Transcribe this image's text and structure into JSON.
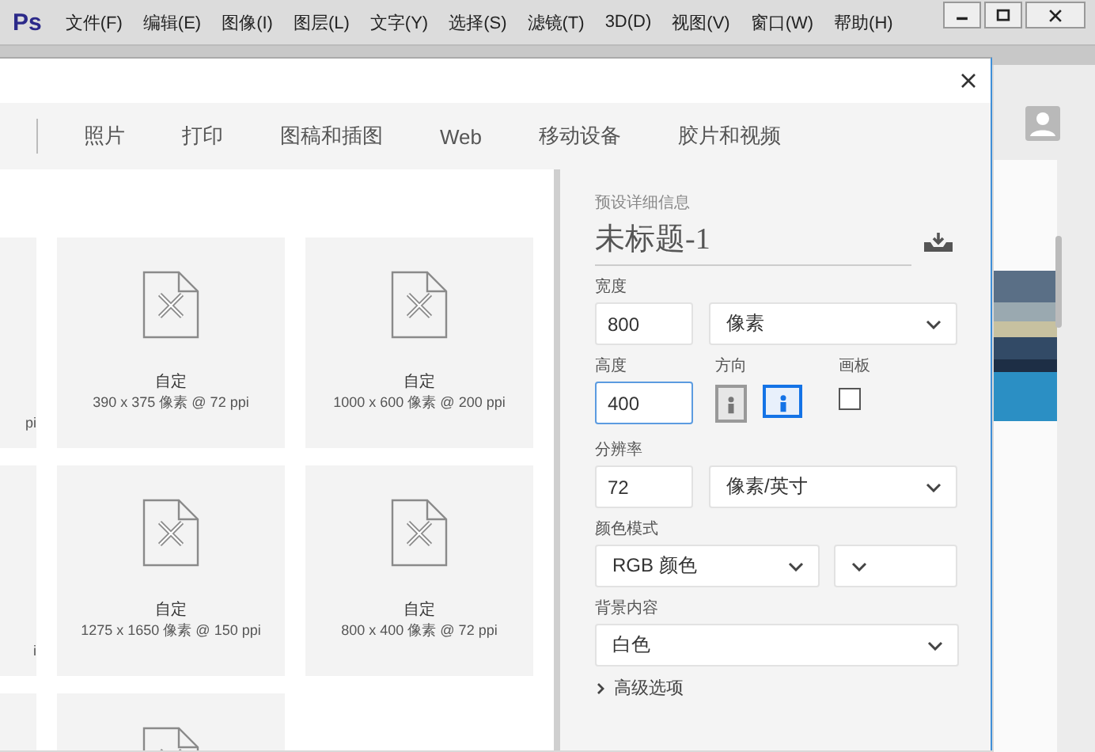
{
  "app": {
    "logo": "Ps",
    "menu": [
      "文件(F)",
      "编辑(E)",
      "图像(I)",
      "图层(L)",
      "文字(Y)",
      "选择(S)",
      "滤镜(T)",
      "3D(D)",
      "视图(V)",
      "窗口(W)",
      "帮助(H)"
    ]
  },
  "dialog": {
    "tabs": [
      {
        "label": "照片"
      },
      {
        "label": "打印"
      },
      {
        "label": "图稿和插图"
      },
      {
        "label": "Web"
      },
      {
        "label": "移动设备"
      },
      {
        "label": "胶片和视频"
      }
    ],
    "presets": [
      {
        "kind": "partial",
        "detail": "pi"
      },
      {
        "kind": "card",
        "name": "自定",
        "detail": "390 x 375 像素 @ 72 ppi"
      },
      {
        "kind": "card",
        "name": "自定",
        "detail": "1000 x 600 像素 @ 200 ppi"
      },
      {
        "kind": "partial",
        "detail": "i"
      },
      {
        "kind": "card",
        "name": "自定",
        "detail": "1275 x 1650 像素 @ 150 ppi"
      },
      {
        "kind": "card",
        "name": "自定",
        "detail": "800 x 400 像素 @ 72 ppi"
      },
      {
        "kind": "partial"
      },
      {
        "kind": "cut"
      }
    ],
    "details": {
      "heading": "预设详细信息",
      "title": "未标题-1",
      "width": {
        "label": "宽度",
        "value": "800",
        "unit": "像素"
      },
      "height": {
        "label": "高度",
        "value": "400",
        "focused": true
      },
      "orientation": {
        "label": "方向",
        "options": [
          {
            "kind": "portrait",
            "selected": false
          },
          {
            "kind": "landscape",
            "selected": true
          }
        ]
      },
      "artboard": {
        "label": "画板",
        "checked": false
      },
      "resolution": {
        "label": "分辨率",
        "value": "72",
        "unit": "像素/英寸"
      },
      "color_mode": {
        "label": "颜色模式",
        "value": "RGB 颜色"
      },
      "background": {
        "label": "背景内容",
        "value": "白色"
      },
      "advanced": {
        "label": "高级选项",
        "expanded": false
      }
    }
  }
}
